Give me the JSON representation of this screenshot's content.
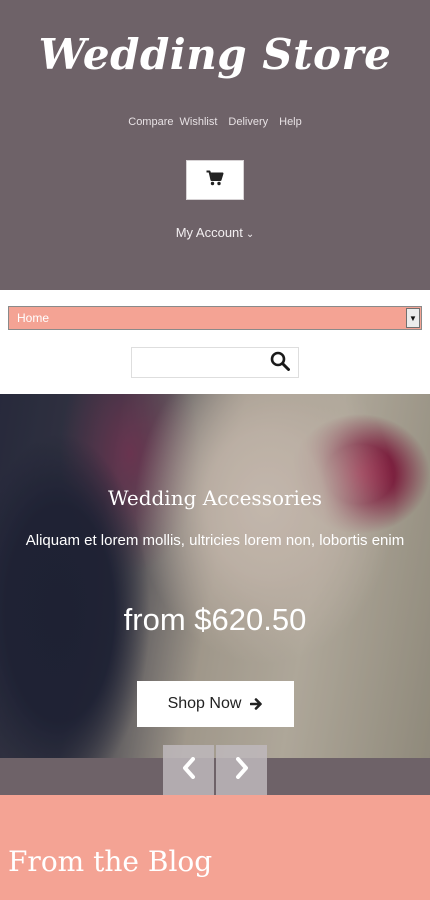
{
  "header": {
    "logo": "Wedding Store",
    "links": [
      "Compare",
      "Wishlist",
      "Delivery",
      "Help"
    ],
    "cart_icon": "cart-icon",
    "account_label": "My Account",
    "account_icon": "chevron-down-icon",
    "background_color": "#6e6268"
  },
  "nav": {
    "selected": "Home",
    "background_color": "#f4a394"
  },
  "search": {
    "placeholder": "",
    "icon": "search-icon"
  },
  "hero": {
    "title": "Wedding Accessories",
    "description": "Aliquam et lorem mollis, ultricies lorem non, lobortis enim",
    "price": "from $620.50",
    "button_label": "Shop Now",
    "button_icon": "arrow-right-icon",
    "prev_icon": "chevron-left-icon",
    "next_icon": "chevron-right-icon"
  },
  "blog": {
    "title": "From the Blog",
    "background_color": "#f4a394"
  }
}
